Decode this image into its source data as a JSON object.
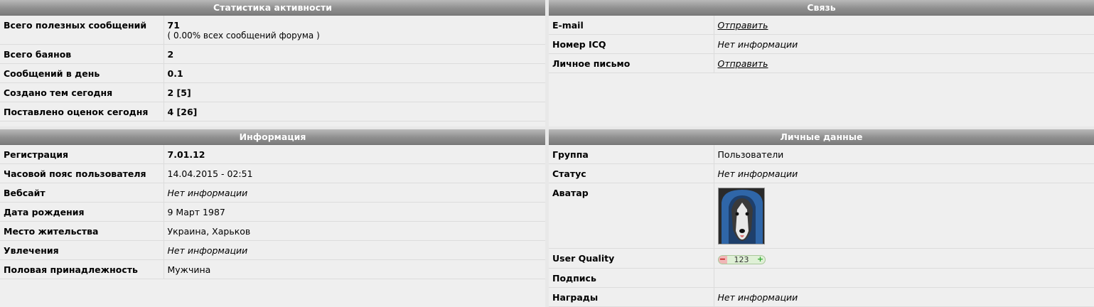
{
  "stats": {
    "title": "Статистика активности",
    "rows": [
      {
        "label": "Всего полезных сообщений",
        "value": "71",
        "sub": "( 0.00% всех сообщений форума )"
      },
      {
        "label": "Всего баянов",
        "value": "2"
      },
      {
        "label": "Сообщений в день",
        "value": "0.1"
      },
      {
        "label": "Создано тем сегодня",
        "value": "2 [5]"
      },
      {
        "label": "Поставлено оценок сегодня",
        "value": "4 [26]"
      }
    ]
  },
  "contact": {
    "title": "Связь",
    "rows": [
      {
        "label": "E-mail",
        "value": "Отправить"
      },
      {
        "label": "Номер ICQ",
        "value": "Нет информации"
      },
      {
        "label": "Личное письмо",
        "value": "Отправить"
      }
    ]
  },
  "info": {
    "title": "Информация",
    "rows": [
      {
        "label": "Регистрация",
        "value": "7.01.12"
      },
      {
        "label": "Часовой пояс пользователя",
        "value": "14.04.2015 - 02:51"
      },
      {
        "label": "Вебсайт",
        "value": "Нет информации"
      },
      {
        "label": "Дата рождения",
        "value": "9 Март 1987"
      },
      {
        "label": "Место жительства",
        "value": "Украина, Харьков"
      },
      {
        "label": "Увлечения",
        "value": "Нет информации"
      },
      {
        "label": "Половая принадлежность",
        "value": "Мужчина"
      }
    ]
  },
  "personal": {
    "title": "Личные данные",
    "rows": [
      {
        "label": "Группа",
        "value": "Пользователи"
      },
      {
        "label": "Статус",
        "value": "Нет информации"
      },
      {
        "label": "Аватар",
        "avatar_icon": "husky-in-hoodie-avatar"
      },
      {
        "label": "User Quality",
        "quality": {
          "minus": "−",
          "value": "123",
          "plus": "+"
        }
      },
      {
        "label": "Подпись",
        "value": ""
      },
      {
        "label": "Награды",
        "value": "Нет информации"
      }
    ]
  },
  "colors": {
    "header_bg": "#8f8f8f",
    "panel_bg": "#efefef",
    "page_bg": "#e8e8e8"
  }
}
